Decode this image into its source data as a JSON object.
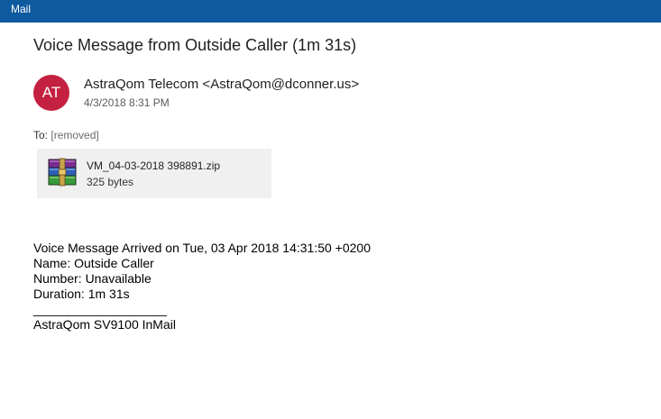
{
  "window": {
    "app_title": "Mail"
  },
  "message": {
    "subject": "Voice Message from Outside Caller (1m 31s)",
    "avatar_initials": "AT",
    "avatar_color": "#c4203f",
    "sender": "AstraQom Telecom <AstraQom@dconner.us>",
    "date": "4/3/2018 8:31 PM",
    "to_label": "To:",
    "to_value": "[removed]"
  },
  "attachment": {
    "icon": "winrar-archive-icon",
    "file_name": "VM_04-03-2018 398891.zip",
    "file_size": "325 bytes"
  },
  "body": {
    "line1": "Voice Message Arrived on Tue, 03 Apr 2018 14:31:50 +0200",
    "line2": "Name: Outside Caller",
    "line3": "Number: Unavailable",
    "line4": "Duration: 1m 31s",
    "separator": "___________________",
    "signature": "AstraQom SV9100 InMail"
  },
  "colors": {
    "titlebar": "#0e5a9e"
  }
}
